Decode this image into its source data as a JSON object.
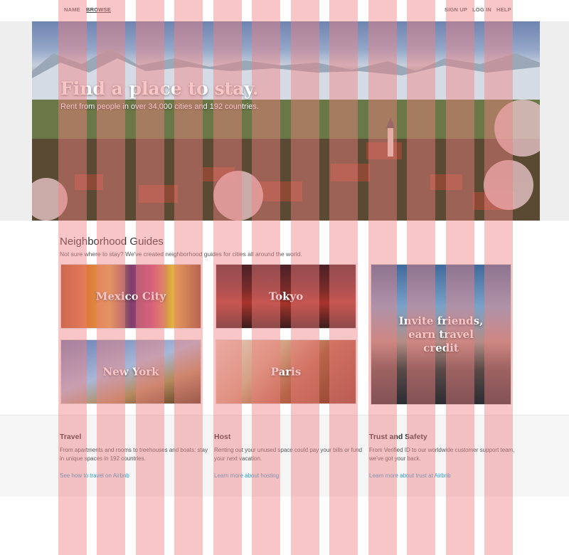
{
  "nav": {
    "left": [
      "NAME",
      "BROWSE"
    ],
    "right": [
      "SIGN UP",
      "LOG IN",
      "HELP"
    ]
  },
  "hero": {
    "title": "Find a place to stay.",
    "subtitle": "Rent from people in over 34,000 cities and 192 countries."
  },
  "guides": {
    "title": "Neighborhood Guides",
    "subtitle": "Not sure where to stay? We've created neighborhood guides for cities all around the world.",
    "tiles": [
      "Mexico City",
      "Tokyo",
      "New York",
      "Paris"
    ],
    "promo": "Invite friends, earn travel credit"
  },
  "info": {
    "columns": [
      {
        "title": "Travel",
        "text": "From apartments and rooms to treehouses and boats: stay in unique spaces in 192 countries.",
        "link": "See how to travel on Airbnb"
      },
      {
        "title": "Host",
        "text": "Renting out your unused space could pay your bills or fund your next vacation.",
        "link": "Learn more about hosting"
      },
      {
        "title": "Trust and Safety",
        "text": "From Verified ID to our worldwide customer support team, we've got your back.",
        "link": "Learn more about trust at Airbnb"
      }
    ]
  },
  "colors": {
    "grid_overlay": "#f08080",
    "link": "#2a9fd6",
    "info_background": "#f5f5f5"
  }
}
